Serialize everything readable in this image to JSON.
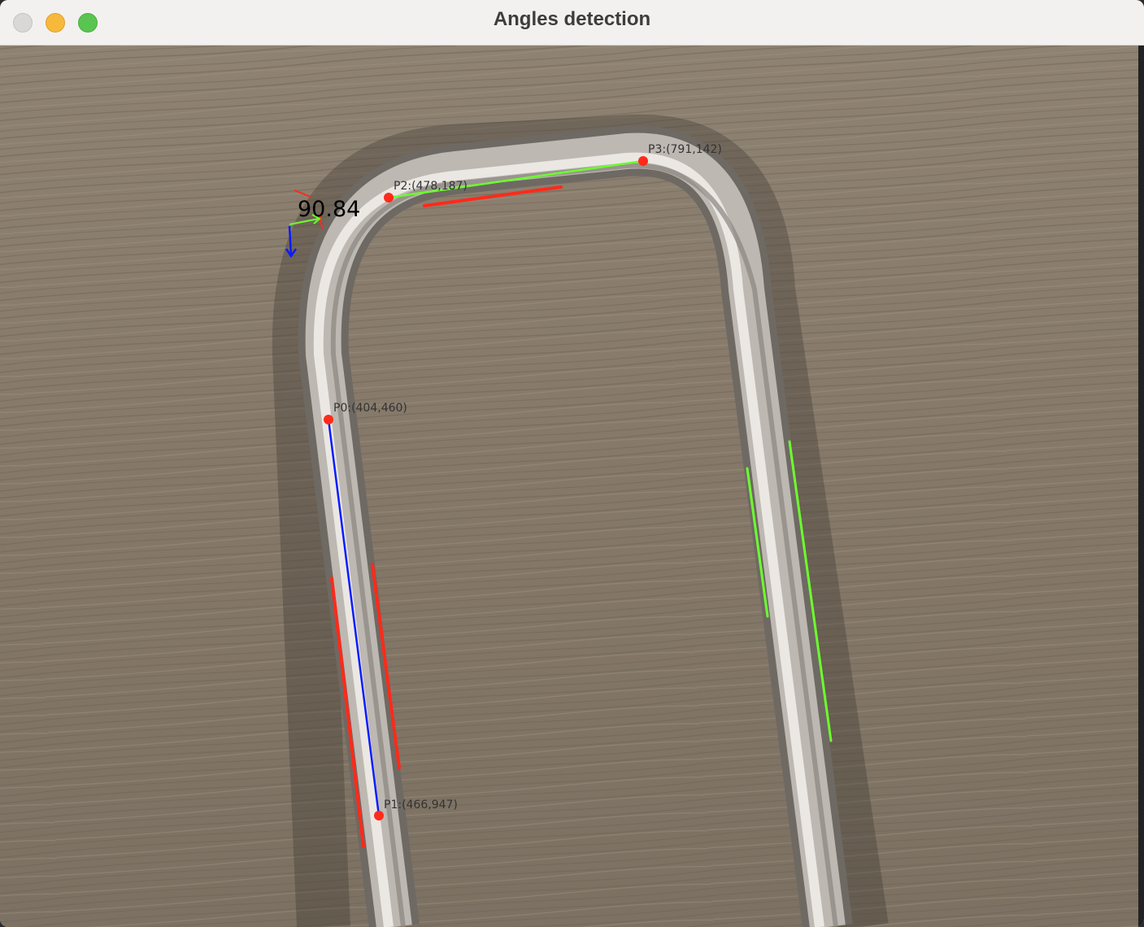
{
  "window": {
    "title": "Angles detection"
  },
  "overlay": {
    "angle_value": "90.84",
    "point_labels": [
      "P0:(404,460)",
      "P1:(466,947)",
      "P2:(478,187)",
      "P3:(791,142)"
    ],
    "colors": {
      "marker": "#ff2a1a",
      "blue_line": "#0b1bff",
      "green_line": "#6cff2e",
      "red_line": "#ff2a1a",
      "label_text": "#333333",
      "angle_text": "#000000"
    }
  }
}
